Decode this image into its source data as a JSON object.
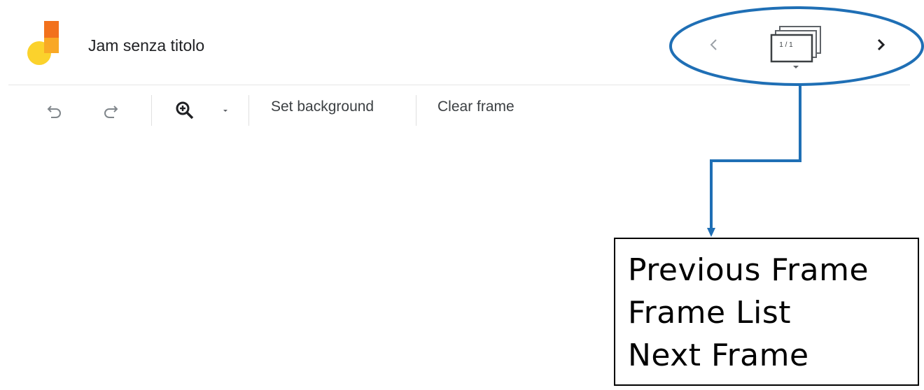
{
  "header": {
    "doc_title": "Jam senza titolo",
    "logo_icon": "jamboard-logo-icon"
  },
  "toolbar": {
    "undo_icon": "undo-icon",
    "redo_icon": "redo-icon",
    "zoom_icon": "zoom-in-icon",
    "zoom_dropdown_icon": "caret-down-icon",
    "set_background_label": "Set background",
    "clear_frame_label": "Clear frame"
  },
  "frame_nav": {
    "previous_icon": "chevron-left-icon",
    "next_icon": "chevron-right-icon",
    "frame_list_icon": "frames-stack-icon",
    "counter": "1 / 1"
  },
  "annotation": {
    "callout_lines": [
      "Previous Frame",
      "Frame List",
      "Next Frame"
    ],
    "highlight_color": "#1f6fb5",
    "box_border_color": "#000000"
  },
  "colors": {
    "logo_orange": "#f2711c",
    "logo_light_orange": "#f9a825",
    "logo_yellow": "#fbd22c",
    "icon_gray": "#5f6368",
    "icon_dark": "#202124"
  }
}
